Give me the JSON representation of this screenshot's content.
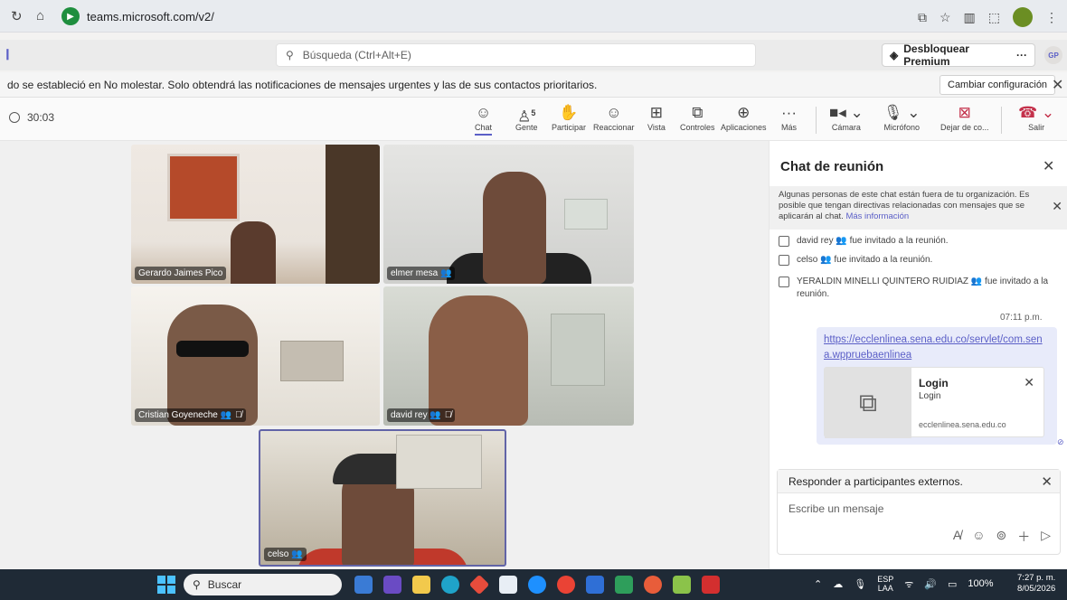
{
  "browser": {
    "url": "teams.microsoft.com/v2/"
  },
  "teams_header": {
    "search_placeholder": "Búsqueda (Ctrl+Alt+E)",
    "premium_label": "Desbloquear Premium",
    "premium_more": "···",
    "user_initials": "GP"
  },
  "notice": {
    "text": "do se estableció en No molestar. Solo obtendrá las notificaciones de mensajes urgentes y las de sus contactos prioritarios.",
    "button": "Cambiar configuración"
  },
  "meeting_toolbar": {
    "timer": "30:03",
    "people_count": "5",
    "buttons": [
      {
        "label": "Chat",
        "icon": "chat-icon"
      },
      {
        "label": "Gente",
        "icon": "people-icon"
      },
      {
        "label": "Participar",
        "icon": "raise-hand-icon"
      },
      {
        "label": "Reaccionar",
        "icon": "smile-icon"
      },
      {
        "label": "Vista",
        "icon": "grid-icon"
      },
      {
        "label": "Controles",
        "icon": "controls-icon"
      },
      {
        "label": "Aplicaciones",
        "icon": "plus-icon"
      },
      {
        "label": "Más",
        "icon": "more-icon"
      },
      {
        "label": "Cámara",
        "icon": "camera-icon"
      },
      {
        "label": "Micrófono",
        "icon": "mic-icon"
      },
      {
        "label": "Dejar de co...",
        "icon": "stop-share-icon"
      },
      {
        "label": "Salir",
        "icon": "hangup-icon"
      }
    ],
    "hangup_color": "#c4314b"
  },
  "participants": [
    {
      "name": "Gerardo Jaimes Pico"
    },
    {
      "name": "elmer mesa"
    },
    {
      "name": "Cristian Goyeneche"
    },
    {
      "name": "david rey"
    },
    {
      "name": "celso"
    }
  ],
  "chat": {
    "title": "Chat de reunión",
    "external_notice": "Algunas personas de este chat están fuera de tu organización. Es posible que tengan directivas relacionadas con mensajes que se aplicarán al chat.",
    "external_link": "Más información",
    "system_messages": [
      {
        "text": "david rey 👥 fue invitado a la reunión."
      },
      {
        "text": "celso 👥 fue invitado a la reunión."
      },
      {
        "text": "YERALDIN MINELLI QUINTERO RUIDIAZ 👥 fue invitado a la reunión."
      }
    ],
    "message_time": "07:11 p.m.",
    "message_link": "https://ecclenlinea.sena.edu.co/servlet/com.sena.wppruebaenlinea",
    "preview": {
      "title": "Login",
      "subtitle": "Login",
      "domain": "ecclenlinea.sena.edu.co"
    },
    "compose": {
      "header": "Responder a participantes externos.",
      "placeholder": "Escribe un mensaje"
    },
    "accent": "#5b5fc7"
  },
  "taskbar": {
    "search_label": "Buscar",
    "lang_1": "ESP",
    "lang_2": "LAA",
    "battery": "100%",
    "time": "7:27 p. m.",
    "date": "8/05/2026"
  }
}
